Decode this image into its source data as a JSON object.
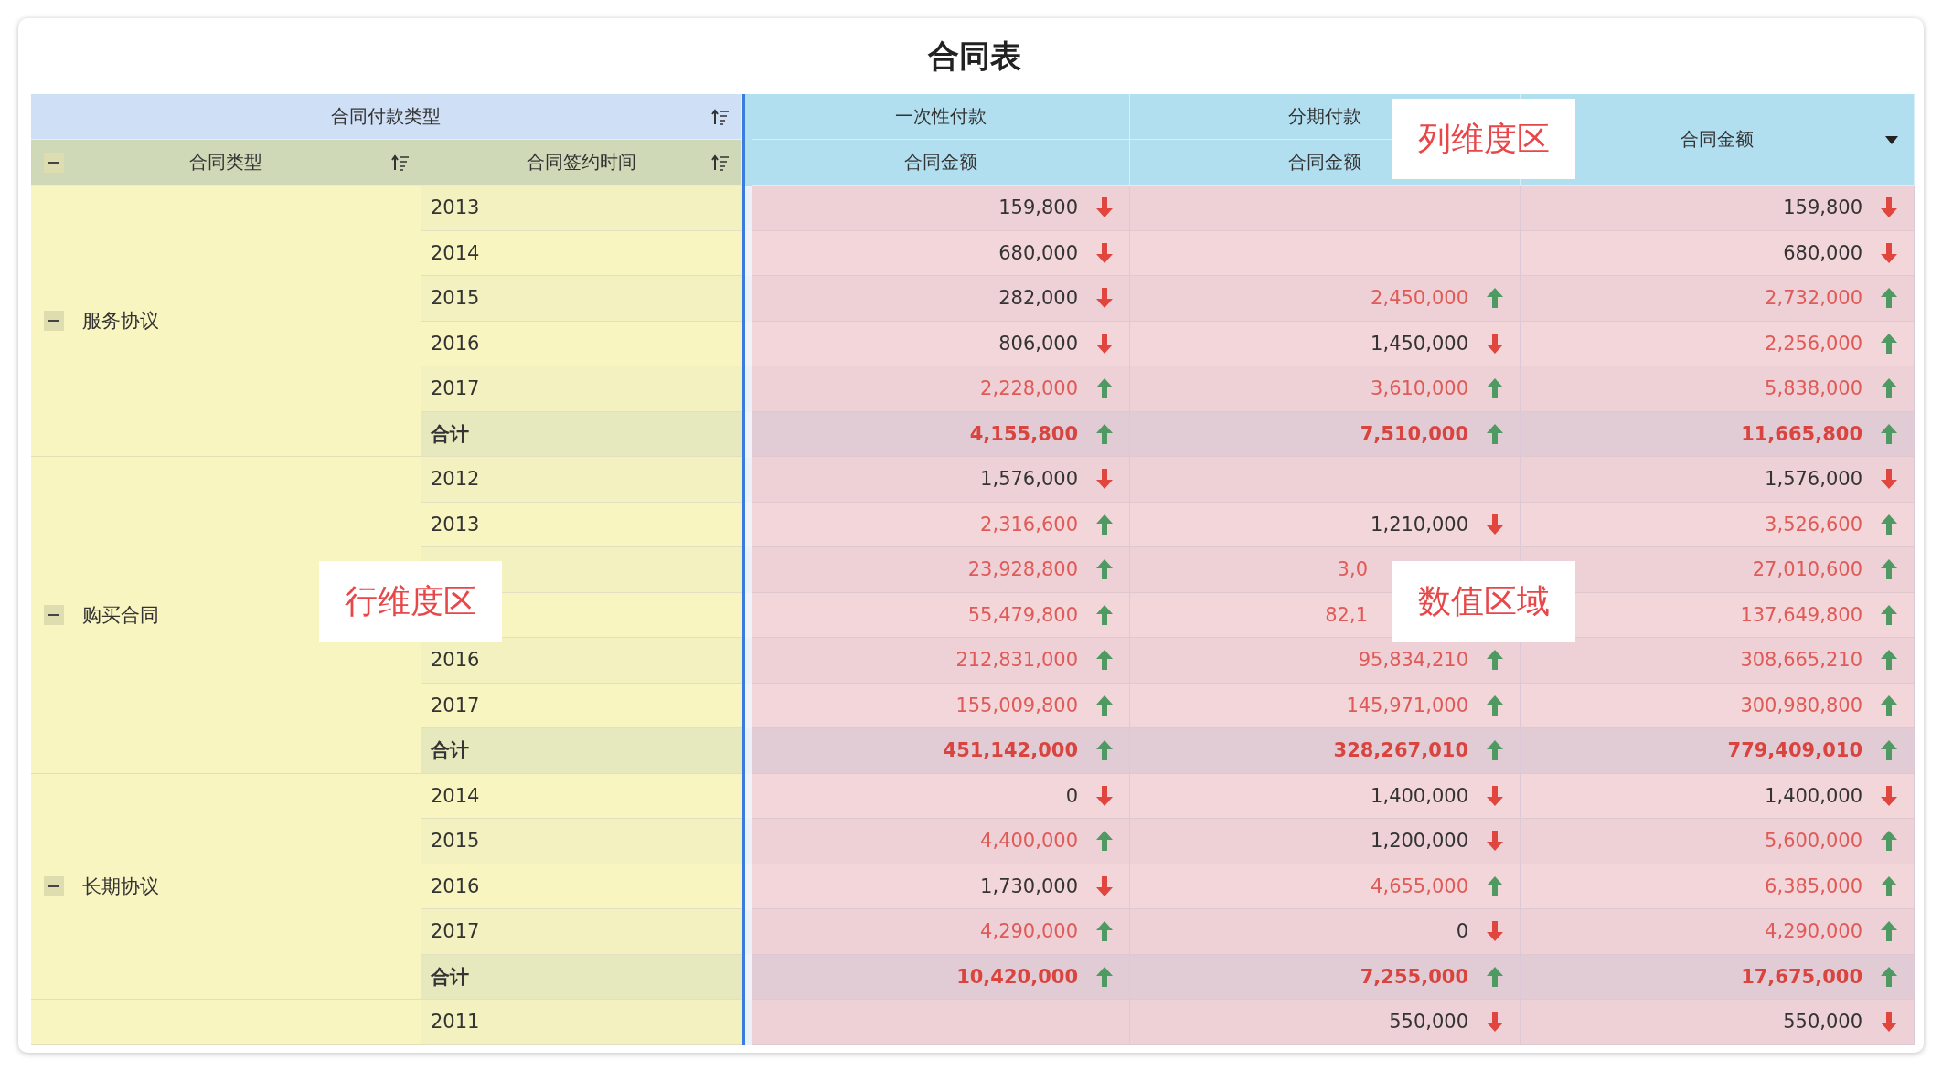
{
  "title": "合同表",
  "row_header": {
    "group_label": "合同付款类型",
    "columns": [
      {
        "label": "合同类型",
        "expanded": true
      },
      {
        "label": "合同签约时间"
      }
    ]
  },
  "column_header": [
    {
      "label": "一次性付款",
      "measure": "合同金额"
    },
    {
      "label": "分期付款",
      "measure": "合同金额"
    },
    {
      "label": "合同金额",
      "has_menu": true
    }
  ],
  "groups": [
    {
      "type": "服务协议",
      "expanded": true,
      "rows": [
        {
          "year": "2013",
          "total": false,
          "cells": [
            {
              "value": "159,800",
              "rising": false
            },
            {},
            {
              "value": "159,800",
              "rising": false
            }
          ]
        },
        {
          "year": "2014",
          "total": false,
          "cells": [
            {
              "value": "680,000",
              "rising": false
            },
            {},
            {
              "value": "680,000",
              "rising": false
            }
          ]
        },
        {
          "year": "2015",
          "total": false,
          "cells": [
            {
              "value": "282,000",
              "rising": false
            },
            {
              "value": "2,450,000",
              "rising": true
            },
            {
              "value": "2,732,000",
              "rising": true
            }
          ]
        },
        {
          "year": "2016",
          "total": false,
          "cells": [
            {
              "value": "806,000",
              "rising": false
            },
            {
              "value": "1,450,000",
              "rising": false
            },
            {
              "value": "2,256,000",
              "rising": true
            }
          ]
        },
        {
          "year": "2017",
          "total": false,
          "cells": [
            {
              "value": "2,228,000",
              "rising": true
            },
            {
              "value": "3,610,000",
              "rising": true
            },
            {
              "value": "5,838,000",
              "rising": true
            }
          ]
        },
        {
          "year": "合计",
          "total": true,
          "cells": [
            {
              "value": "4,155,800",
              "rising": true
            },
            {
              "value": "7,510,000",
              "rising": true
            },
            {
              "value": "11,665,800",
              "rising": true
            }
          ]
        }
      ]
    },
    {
      "type": "购买合同",
      "expanded": true,
      "rows": [
        {
          "year": "2012",
          "total": false,
          "cells": [
            {
              "value": "1,576,000",
              "rising": false
            },
            {},
            {
              "value": "1,576,000",
              "rising": false
            }
          ]
        },
        {
          "year": "2013",
          "total": false,
          "cells": [
            {
              "value": "2,316,600",
              "rising": true
            },
            {
              "value": "1,210,000",
              "rising": false
            },
            {
              "value": "3,526,600",
              "rising": true
            }
          ]
        },
        {
          "total": false,
          "cells": [
            {
              "value": "23,928,800",
              "rising": true
            },
            {
              "value": "3,0",
              "covered": true
            },
            {
              "value": "27,010,600",
              "rising": true
            }
          ]
        },
        {
          "total": false,
          "cells": [
            {
              "value": "55,479,800",
              "rising": true
            },
            {
              "value": "82,1",
              "covered": true
            },
            {
              "value": "137,649,800",
              "rising": true
            }
          ]
        },
        {
          "year": "2016",
          "total": false,
          "cells": [
            {
              "value": "212,831,000",
              "rising": true
            },
            {
              "value": "95,834,210",
              "rising": true
            },
            {
              "value": "308,665,210",
              "rising": true
            }
          ]
        },
        {
          "year": "2017",
          "total": false,
          "cells": [
            {
              "value": "155,009,800",
              "rising": true
            },
            {
              "value": "145,971,000",
              "rising": true
            },
            {
              "value": "300,980,800",
              "rising": true
            }
          ]
        },
        {
          "year": "合计",
          "total": true,
          "cells": [
            {
              "value": "451,142,000",
              "rising": true
            },
            {
              "value": "328,267,010",
              "rising": true
            },
            {
              "value": "779,409,010",
              "rising": true
            }
          ]
        }
      ]
    },
    {
      "type": "长期协议",
      "expanded": true,
      "rows": [
        {
          "year": "2014",
          "total": false,
          "cells": [
            {
              "value": "0",
              "rising": false
            },
            {
              "value": "1,400,000",
              "rising": false
            },
            {
              "value": "1,400,000",
              "rising": false
            }
          ]
        },
        {
          "year": "2015",
          "total": false,
          "cells": [
            {
              "value": "4,400,000",
              "rising": true
            },
            {
              "value": "1,200,000",
              "rising": false
            },
            {
              "value": "5,600,000",
              "rising": true
            }
          ]
        },
        {
          "year": "2016",
          "total": false,
          "cells": [
            {
              "value": "1,730,000",
              "rising": false
            },
            {
              "value": "4,655,000",
              "rising": true
            },
            {
              "value": "6,385,000",
              "rising": true
            }
          ]
        },
        {
          "year": "2017",
          "total": false,
          "cells": [
            {
              "value": "4,290,000",
              "rising": true
            },
            {
              "value": "0",
              "rising": false
            },
            {
              "value": "4,290,000",
              "rising": true
            }
          ]
        },
        {
          "year": "合计",
          "total": true,
          "cells": [
            {
              "value": "10,420,000",
              "rising": true
            },
            {
              "value": "7,255,000",
              "rising": true
            },
            {
              "value": "17,675,000",
              "rising": true
            }
          ]
        }
      ]
    },
    {
      "rows": [
        {
          "year": "2011",
          "total": false,
          "cells": [
            {},
            {
              "value": "550,000",
              "rising": false
            },
            {
              "value": "550,000",
              "rising": false
            }
          ]
        }
      ]
    }
  ],
  "annotations": [
    {
      "kind": "column",
      "label": "列维度区"
    },
    {
      "kind": "row",
      "label": "行维度区"
    },
    {
      "kind": "value",
      "label": "数值区域"
    }
  ]
}
